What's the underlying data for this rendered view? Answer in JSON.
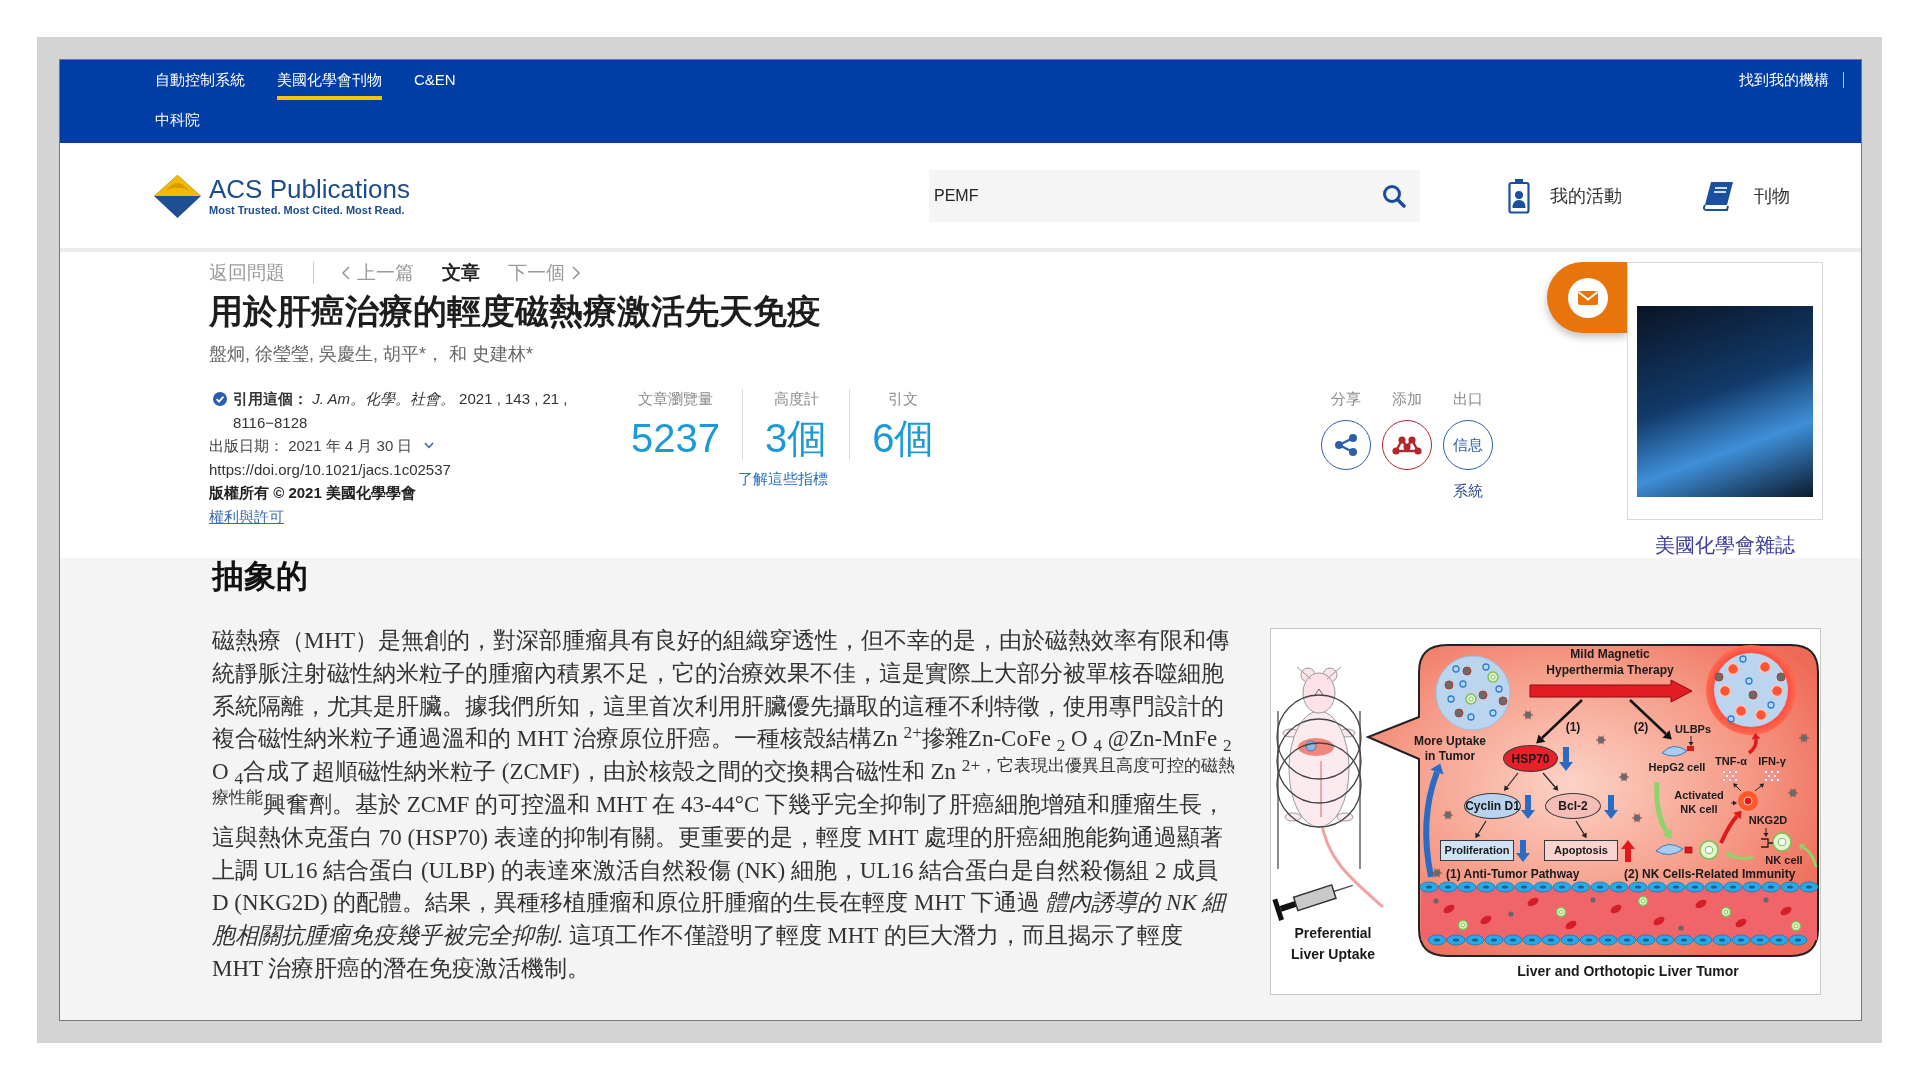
{
  "top_nav": {
    "tabs": [
      {
        "label": "自動控制系統",
        "selected": false
      },
      {
        "label": "美國化學會刊物",
        "selected": true
      },
      {
        "label": "C&EN",
        "selected": false
      }
    ],
    "institution": "中科院",
    "find_institution": "找到我的機構"
  },
  "header": {
    "logo": {
      "name": "ACS Publications",
      "tagline": "Most Trusted. Most Cited. Most Read."
    },
    "search": {
      "value": "PEMF"
    },
    "links": [
      {
        "label": "我的活動",
        "kind": "activity"
      },
      {
        "label": "刊物",
        "kind": "publications"
      }
    ]
  },
  "article": {
    "breadcrumbs": [
      {
        "label": "返回問題",
        "kind": "back",
        "selected": false
      },
      {
        "label": "上一篇",
        "kind": "previous",
        "selected": false
      },
      {
        "label": "文章",
        "kind": "current",
        "selected": true
      },
      {
        "label": "下一個",
        "kind": "next",
        "selected": false
      }
    ],
    "title": "用於肝癌治療的輕度磁熱療激活先天免疫",
    "authors": "盤炯, 徐瑩瑩, 吳慶生, 胡平*， 和 史建林*",
    "citation": "**引用這個：** *J. Am。化學。社會。*  2021 , 143 , 21 , 8116−8128",
    "published": "出版日期： 2021 年 4 月 30 日",
    "doi": "https://doi.org/10.1021/jacs.1c02537",
    "copyright": "版權所有 © 2021 美國化學學會",
    "permissions": "權利與許可",
    "metrics": [
      {
        "label": "文章瀏覽量",
        "value": "5237"
      },
      {
        "label": "高度計",
        "value": "3個"
      },
      {
        "label": "引文",
        "value": "6個"
      }
    ],
    "metrics_link": "了解這些指標",
    "actions": [
      {
        "label": "分享",
        "kind": "share"
      },
      {
        "label": "添加",
        "kind": "add"
      },
      {
        "label": "出口",
        "kind": "export",
        "text": "信息",
        "caption": "系統"
      }
    ],
    "journal": {
      "caption": "美國化學會雜誌"
    }
  },
  "abstract": {
    "heading": "抽象的",
    "text": "磁熱療（MHT）是無創的，對深部腫瘤具有良好的組織穿透性，但不幸的是，由於磁熱效率有限和傳統靜脈注射磁性納米粒子的腫瘤內積累不足，它的治療效果不佳，這是實際上大部分被單核吞噬細胞系統隔離，尤其是肝臟。據我們所知，這里首次利用肝臟優先攝取的這種不利特徵，使用專門設計的複合磁性納米粒子通過溫和的 MHT 治療原位肝癌。一種核殼結構Zn $^{2+}$摻雜Zn-CoFe $_{2}$ O $_{4}$ @Zn-MnFe $_{2}$ O $_{4}$合成了超順磁性納米粒子 (ZCMF)，由於核殼之間的交換耦合磁性和 Zn $^{2+，它表現出優異且高度可控的磁熱療性能}$興奮劑。基於 ZCMF 的可控溫和 MHT 在 43-44°C 下幾乎完全抑制了肝癌細胞增殖和腫瘤生長，這與熱休克蛋白 70 (HSP70) 表達的抑制有關。更重要的是，輕度 MHT 處理的肝癌細胞能夠通過顯著上調 UL16 結合蛋白 (ULBP) 的表達來激活自然殺傷 (NK) 細胞，UL16 結合蛋白是自然殺傷組 2 成員 D (NKG2D) 的配體。結果，異種移植腫瘤和原位肝腫瘤的生長在輕度 MHT 下通過 *體內誘導的 NK 細胞相關抗腫瘤免疫幾乎被完全抑制*. 這項工作不僅證明了輕度 MHT 的巨大潛力，而且揭示了輕度 MHT 治療肝癌的潛在免疫激活機制。",
    "figure": {
      "therapy": "Mild Magnetic Hyperthermia Therapy",
      "uptake": "More Uptake in Tumor",
      "branches": [
        "(1)",
        "(2)"
      ],
      "markers": [
        {
          "label": "HSP70",
          "color": "#e8202a",
          "increased": false
        },
        {
          "label": "Cyclin D1",
          "color": "#b9d3ee",
          "increased": false
        },
        {
          "label": "Bcl-2",
          "color": "#f6bdb8",
          "increased": false
        }
      ],
      "outcomes": [
        {
          "label": "Proliferation",
          "color": "#cfe2f6",
          "increased": false
        },
        {
          "label": "Apoptosis",
          "color": "#f9d3cf",
          "increased": true
        }
      ],
      "pathways": [
        "(1) Anti-Tumor Pathway",
        "(2) NK Cells-Related Immunity"
      ],
      "ligand": "ULBPs",
      "tumor_cell": "HepG2 cell",
      "cytokines": [
        "TNF-α",
        "IFN-γ"
      ],
      "activated_cell": "Activated NK cell",
      "receptor": "NKG2D",
      "nk_cell": "NK cell",
      "mouse_caption": "Preferential Liver Uptake",
      "caption": "Liver and Orthotopic Liver Tumor"
    }
  }
}
